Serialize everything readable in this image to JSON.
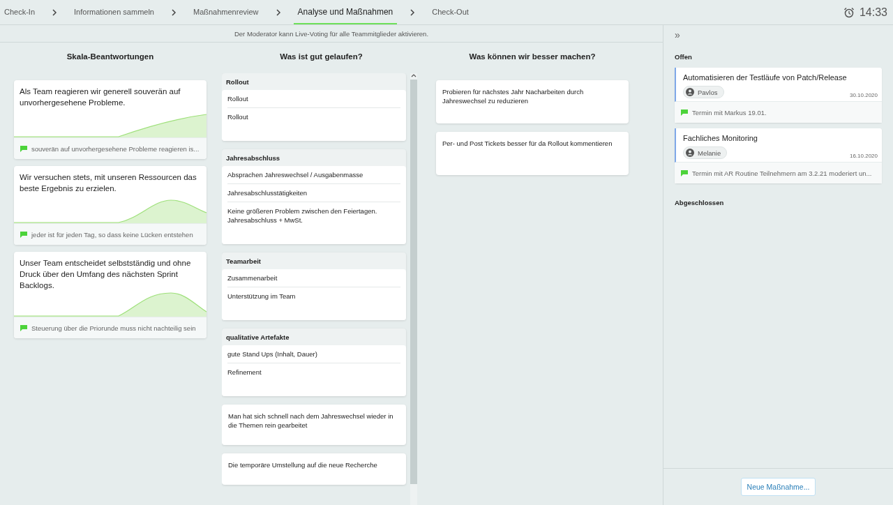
{
  "steps": [
    {
      "label": "Check-In",
      "selected": false
    },
    {
      "label": "Informationen sammeln",
      "selected": false
    },
    {
      "label": "Maßnahmenreview",
      "selected": false
    },
    {
      "label": "Analyse und Maßnahmen",
      "selected": true
    },
    {
      "label": "Check-Out",
      "selected": false
    }
  ],
  "timer": "14:33",
  "info": "Der Moderator kann Live-Voting für alle Teammitglieder aktivieren.",
  "scale": {
    "title": "Skala-Beantwortungen",
    "cards": [
      {
        "statement": "Als Team reagieren wir generell souverän auf unvorhergesehene Probleme.",
        "comment": "souverän auf unvorhergesehene Probleme reagieren is..."
      },
      {
        "statement": "Wir versuchen stets, mit unseren Ressourcen das beste Ergebnis zu erzielen.",
        "comment": "jeder ist für jeden Tag, so dass keine Lücken entstehen"
      },
      {
        "statement": "Unser Team entscheidet selbstständig und ohne Druck über den Umfang des nächsten Sprint Backlogs.",
        "comment": "Steuerung über die Priorunde muss nicht nachteilig sein"
      }
    ]
  },
  "good": {
    "title": "Was ist gut gelaufen?",
    "entries": [
      {
        "kind": "group",
        "title": "Rollout",
        "items": [
          "Rollout",
          "Rollout"
        ]
      },
      {
        "kind": "group",
        "title": "Jahresabschluss",
        "items": [
          "Absprachen Jahreswechsel / Ausgabenmasse",
          "Jahresabschlusstätigkeiten",
          "Keine größeren Problem zwischen den Feiertagen. Jahresabschluss + MwSt."
        ]
      },
      {
        "kind": "group",
        "title": "Teamarbeit",
        "items": [
          "Zusammenarbeit",
          "Unterstützung im Team"
        ]
      },
      {
        "kind": "group",
        "title": "qualitative Artefakte",
        "items": [
          "gute Stand Ups (Inhalt, Dauer)",
          "Refinement"
        ]
      },
      {
        "kind": "card",
        "text": "Man hat sich schnell nach dem Jahreswechsel wieder in die Themen rein gearbeitet"
      },
      {
        "kind": "card",
        "text": "Die temporäre Umstellung auf die neue Recherche"
      }
    ]
  },
  "better": {
    "title": "Was können wir besser machen?",
    "cards": [
      "Probieren für nächstes Jahr Nacharbeiten durch Jahreswechsel zu reduzieren",
      "Per- und Post Tickets besser für da Rollout kommentieren"
    ]
  },
  "sidebar": {
    "collapse": "»",
    "open_title": "Offen",
    "measures": [
      {
        "title": "Automatisieren der Testläufe von Patch/Release",
        "assignee": "Pavlos",
        "date": "30.10.2020",
        "comment": "Termin mit Markus 19.01."
      },
      {
        "title": "Fachliches Monitoring",
        "assignee": "Melanie",
        "date": "16.10.2020",
        "comment": "Termin mit AR Routine Teilnehmern am 3.2.21 moderiert un..."
      }
    ],
    "closed_title": "Abgeschlossen",
    "new_button": "Neue Maßnahme..."
  }
}
